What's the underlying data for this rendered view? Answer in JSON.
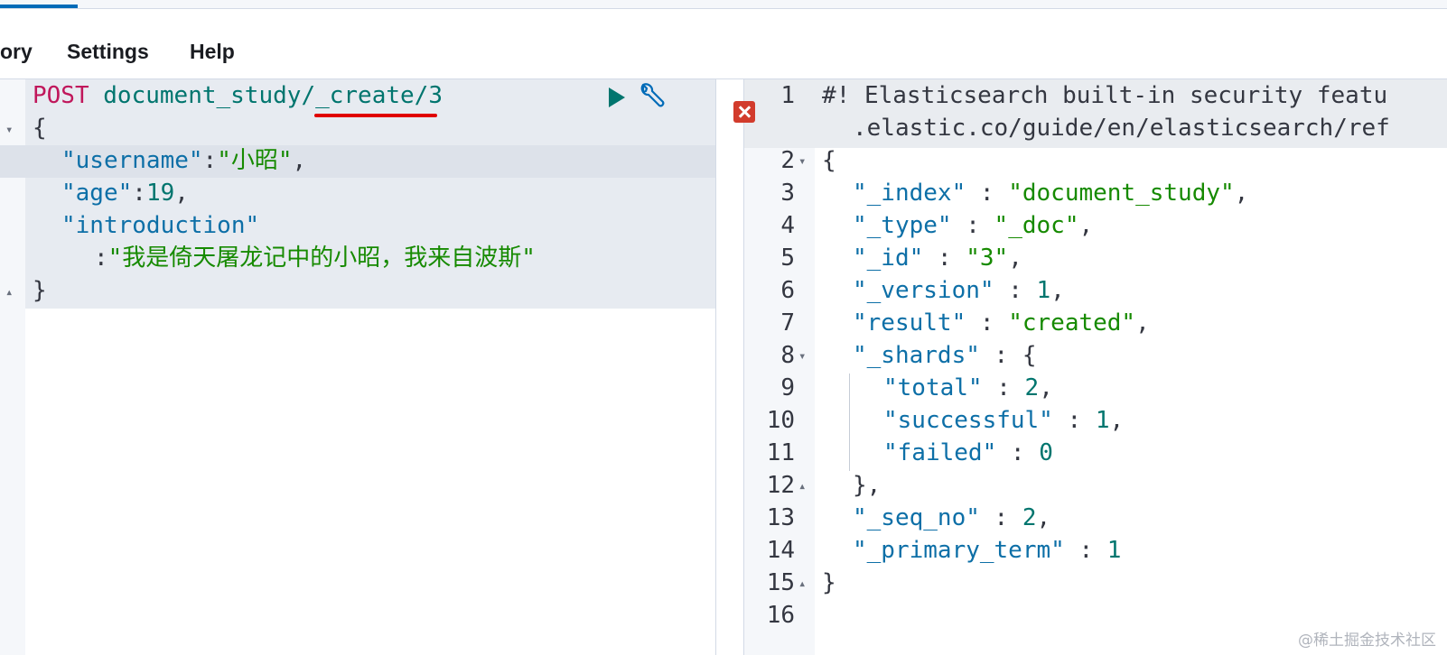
{
  "menu": {
    "history_label": "ory",
    "settings_label": "Settings",
    "help_label": "Help"
  },
  "request": {
    "method": "POST",
    "url_prefix": " document_study",
    "url_action": "/_create",
    "url_suffix": "/3",
    "open_brace": "{",
    "close_brace": "}",
    "line_username_key": "\"username\"",
    "line_username_value": "\"小昭\"",
    "line_age_key": "\"age\"",
    "line_age_value": "19",
    "line_intro_key": "\"introduction\"",
    "line_intro_value": "\"我是倚天屠龙记中的小昭，我来自波斯\""
  },
  "response": {
    "line_numbers": [
      "1",
      "2",
      "3",
      "4",
      "5",
      "6",
      "7",
      "8",
      "9",
      "10",
      "11",
      "12",
      "13",
      "14",
      "15",
      "16"
    ],
    "warning_line_1": "#! Elasticsearch built-in security featu",
    "warning_line_2": ".elastic.co/guide/en/elasticsearch/ref",
    "index_key": "\"_index\"",
    "index_value": "\"document_study\"",
    "type_key": "\"_type\"",
    "type_value": "\"_doc\"",
    "id_key": "\"_id\"",
    "id_value": "\"3\"",
    "version_key": "\"_version\"",
    "version_value": "1",
    "result_key": "\"result\"",
    "result_value": "\"created\"",
    "shards_key": "\"_shards\"",
    "total_key": "\"total\"",
    "total_value": "2",
    "successful_key": "\"successful\"",
    "successful_value": "1",
    "failed_key": "\"failed\"",
    "failed_value": "0",
    "seq_no_key": "\"_seq_no\"",
    "seq_no_value": "2",
    "primary_term_key": "\"_primary_term\"",
    "primary_term_value": "1"
  },
  "watermark": "@稀土掘金技术社区",
  "icons": {
    "run": "play-icon",
    "settings": "wrench-icon",
    "error": "error-x-icon"
  },
  "colors": {
    "accent": "#006bb8",
    "method": "#c0175b",
    "url": "#00756e",
    "key": "#0d6fa7",
    "string": "#168a00",
    "annotation": "#e00000",
    "error": "#d23b2c"
  }
}
